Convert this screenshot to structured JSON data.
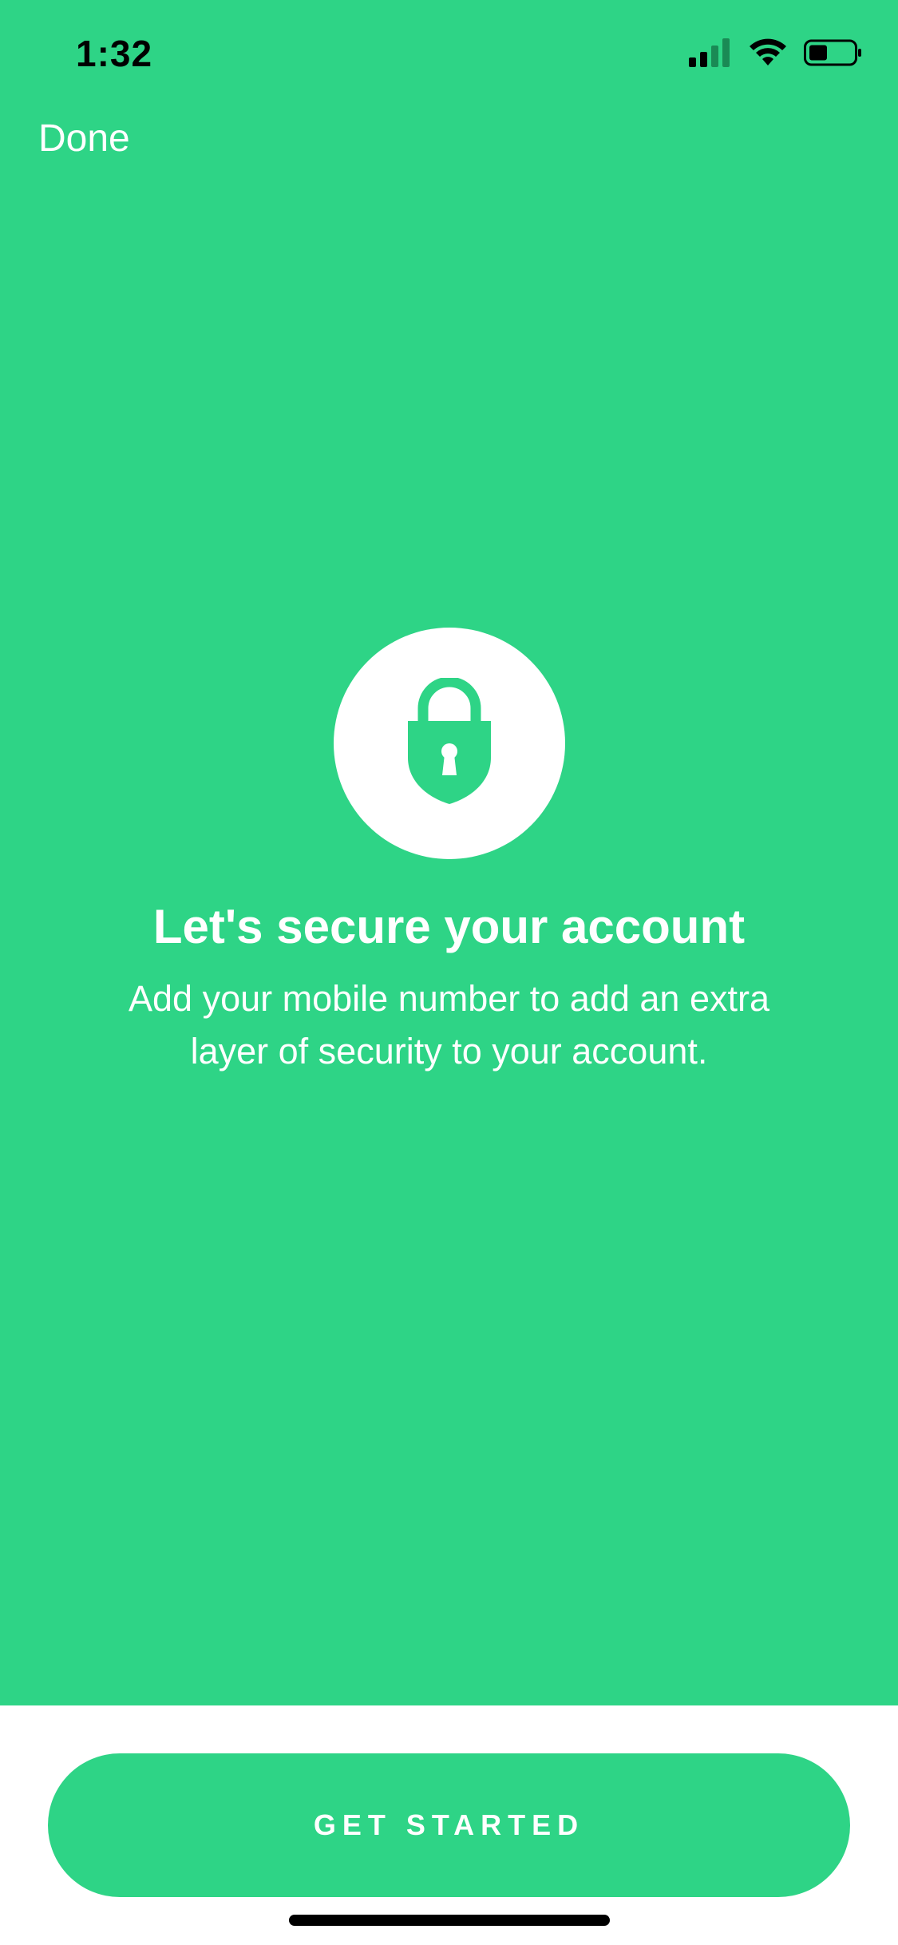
{
  "status_bar": {
    "time": "1:32",
    "icons": [
      "cellular-signal-icon",
      "wifi-icon",
      "battery-icon"
    ]
  },
  "header": {
    "done_label": "Done"
  },
  "main": {
    "icon": "lock-shield-icon",
    "title": "Let's secure your account",
    "subtitle": "Add your mobile number to add an extra layer of security to your account."
  },
  "footer": {
    "cta_label": "GET STARTED"
  },
  "colors": {
    "brand_green": "#2ed486",
    "white": "#ffffff"
  }
}
